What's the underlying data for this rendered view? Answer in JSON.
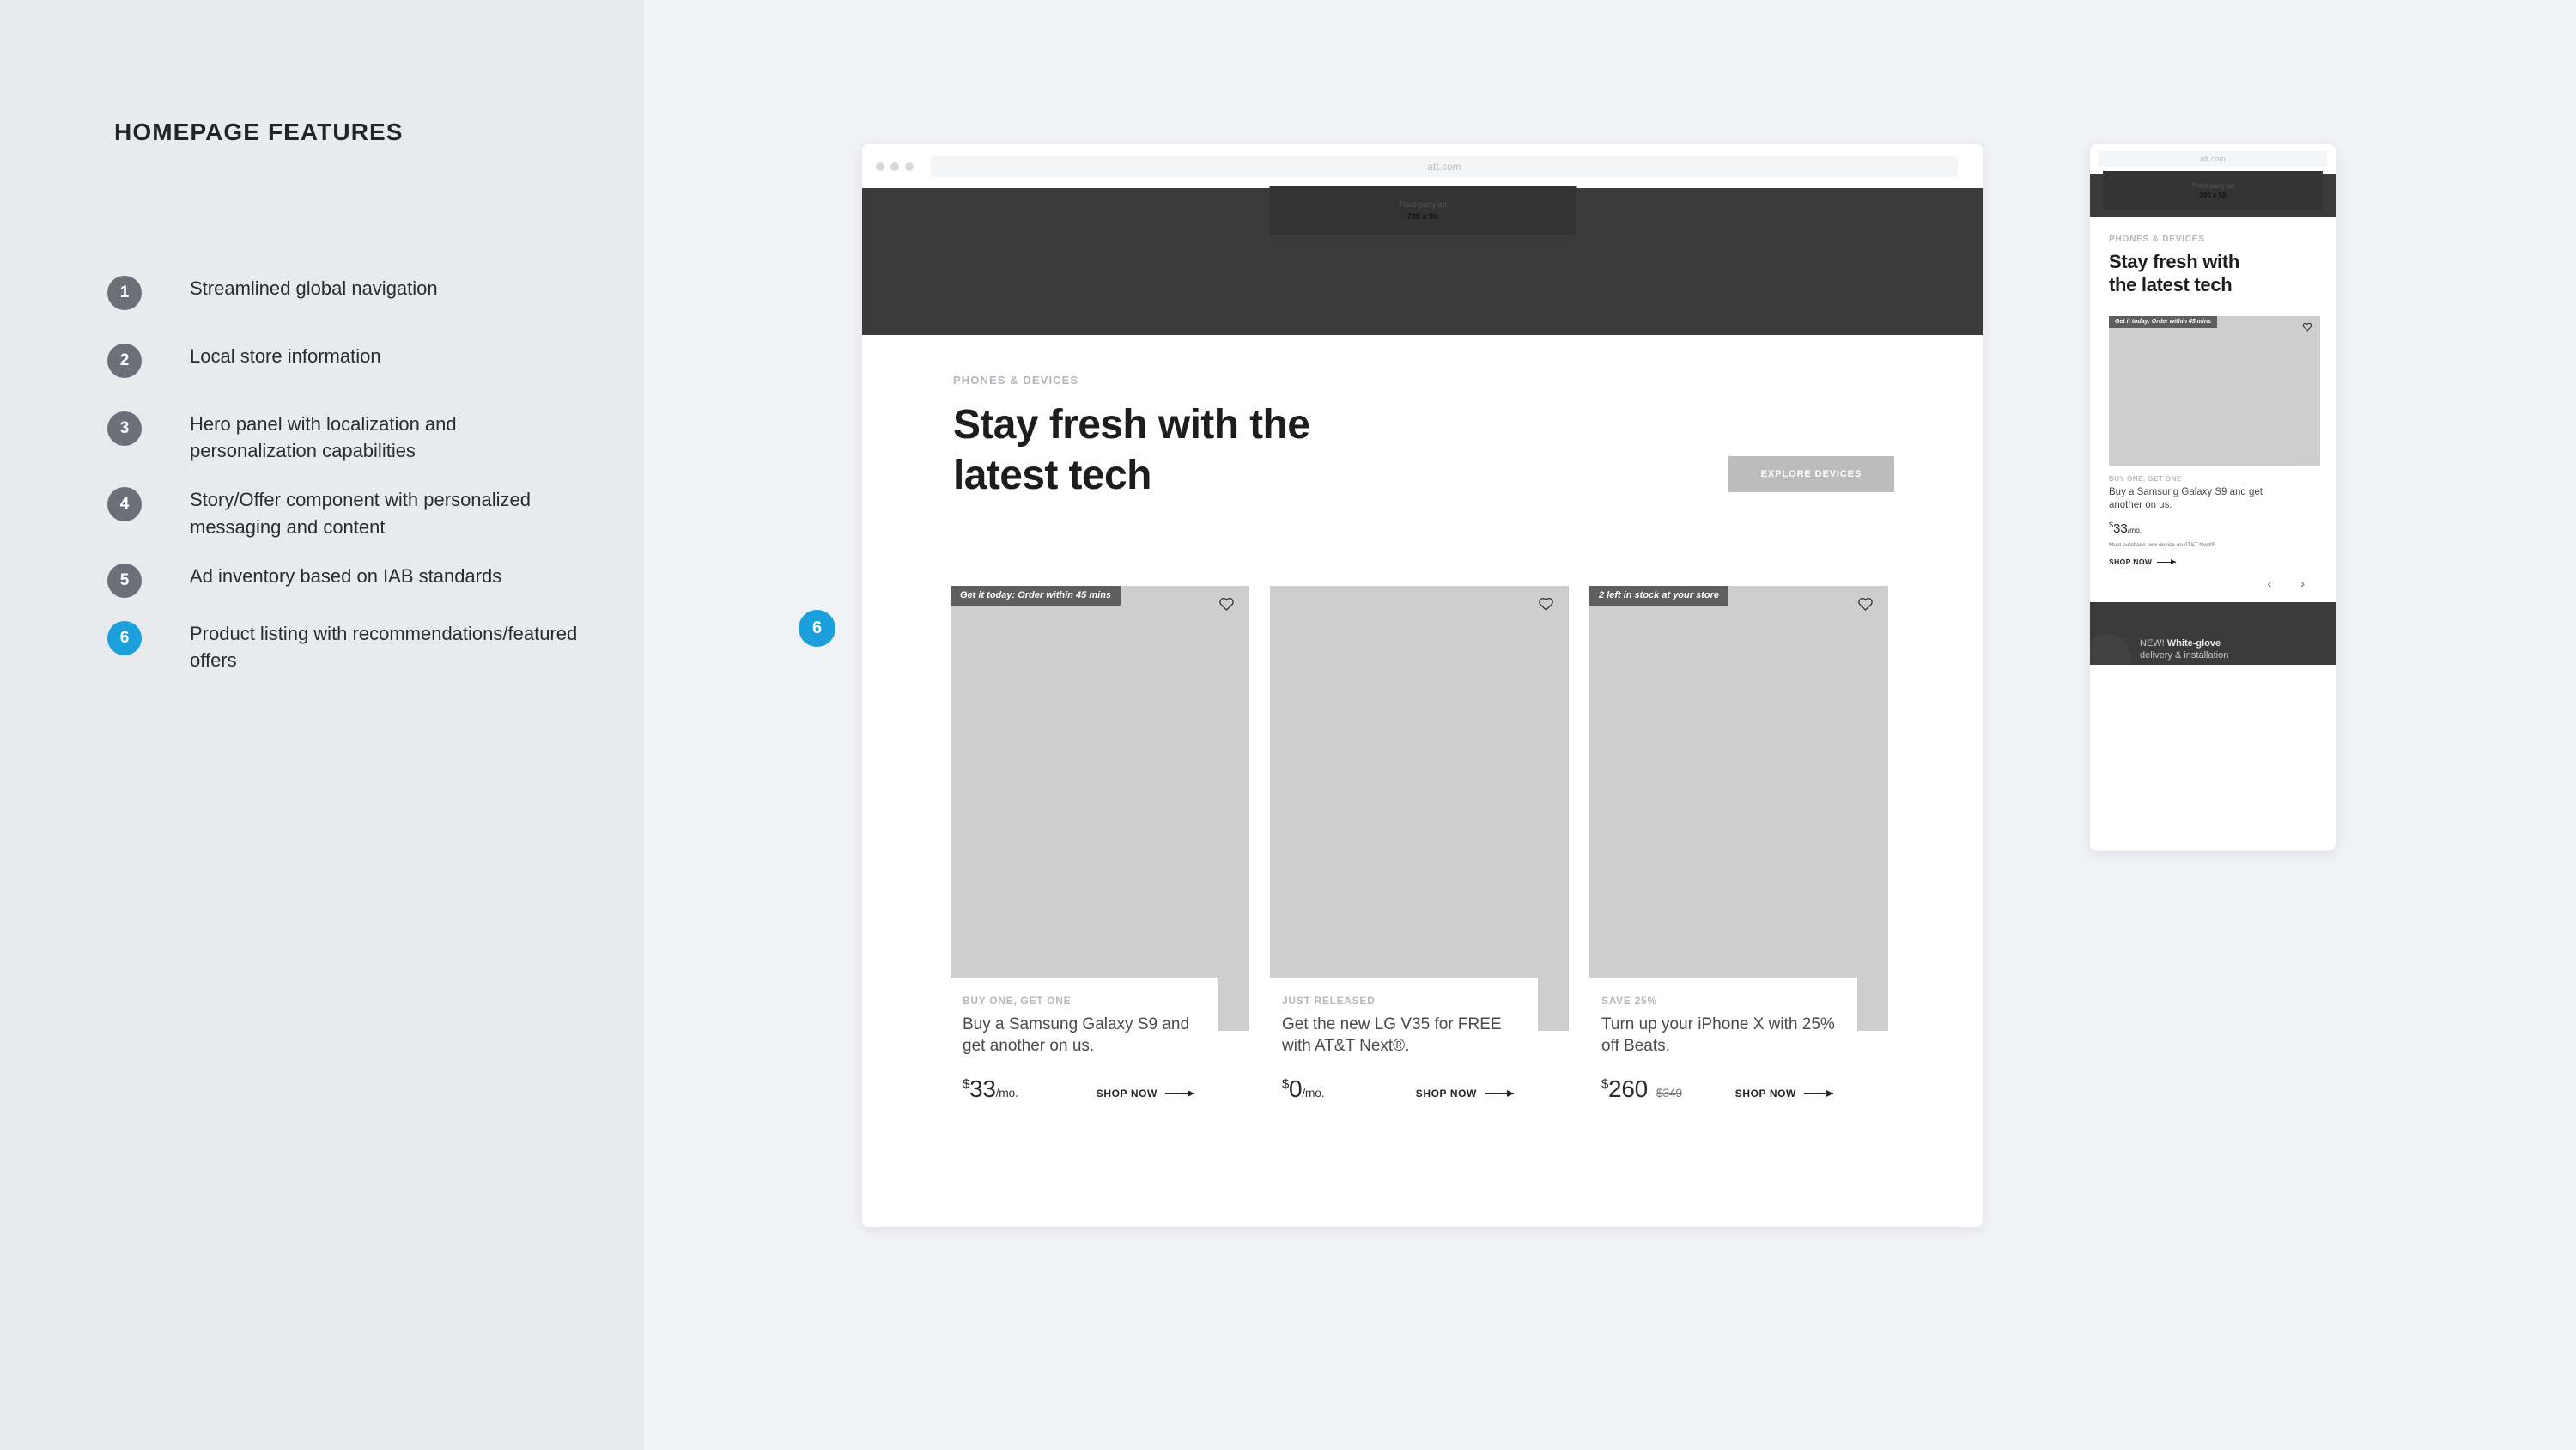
{
  "panel": {
    "title": "HOMEPAGE FEATURES",
    "features": [
      {
        "number": "1",
        "label": "Streamlined global navigation",
        "accent": false
      },
      {
        "number": "2",
        "label": "Local store information",
        "accent": false
      },
      {
        "number": "3",
        "label": "Hero panel with  localization and personalization capabilities",
        "accent": false
      },
      {
        "number": "4",
        "label": "Story/Offer component with personalized messaging and content",
        "accent": false
      },
      {
        "number": "5",
        "label": "Ad inventory based on IAB standards",
        "accent": false
      },
      {
        "number": "6",
        "label": "Product listing with recommendations/featured offers",
        "accent": true
      }
    ]
  },
  "callout": {
    "number": "6"
  },
  "colors": {
    "accent": "#1ba0dd",
    "badge_gray": "#6b7078",
    "panel_bg": "#e8eaee",
    "canvas_bg": "#f1f2f6",
    "hero_dark": "#3b3b3b",
    "placeholder_gray": "#cecece",
    "tag_gray": "#5f5f5f"
  },
  "desktop": {
    "url": "att.com",
    "ad": {
      "label": "Third-party ad",
      "size": "728 x 90"
    },
    "eyebrow": "PHONES & DEVICES",
    "headline_line1": "Stay fresh with the",
    "headline_line2": "latest tech",
    "cta": "EXPLORE DEVICES",
    "cards": [
      {
        "badge": "Get it today: Order within 45 mins",
        "kicker": "BUY ONE, GET ONE",
        "desc": "Buy a Samsung Galaxy S9 and get another on us.",
        "currency": "$",
        "price": "33",
        "per": "/mo.",
        "was": "",
        "shop": "SHOP NOW"
      },
      {
        "badge": "",
        "kicker": "JUST RELEASED",
        "desc": "Get the new LG V35 for FREE with AT&T Next®.",
        "currency": "$",
        "price": "0",
        "per": "/mo.",
        "was": "",
        "shop": "SHOP NOW"
      },
      {
        "badge": "2 left in stock at your store",
        "kicker": "SAVE 25%",
        "desc": "Turn up your iPhone X with 25% off Beats.",
        "currency": "$",
        "price": "260",
        "per": "",
        "was": "$349",
        "shop": "SHOP NOW"
      }
    ]
  },
  "mobile": {
    "url": "att.com",
    "ad": {
      "label": "Third-party ad",
      "size": "300 x 50"
    },
    "eyebrow": "PHONES & DEVICES",
    "headline_line1": "Stay fresh with",
    "headline_line2": "the latest tech",
    "card": {
      "badge": "Get it today: Order within 45 mins",
      "kicker": "BUY ONE, GET ONE",
      "desc": "Buy a Samsung Galaxy S9 and get another on us.",
      "currency": "$",
      "price": "33",
      "per": "/mo.",
      "disclaimer": "Must purchase new device on AT&T Next®",
      "shop": "SHOP NOW"
    },
    "carousel": {
      "prev": "‹",
      "next": "›"
    },
    "footer": {
      "prefix": "NEW! ",
      "text": "White-glove",
      "sub": "delivery & installation"
    }
  }
}
